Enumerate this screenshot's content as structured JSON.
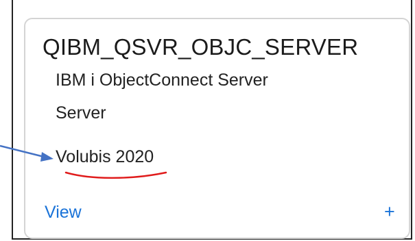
{
  "card": {
    "title": "QIBM_QSVR_OBJC_SERVER",
    "description": "IBM i ObjectConnect Server",
    "type": "Server",
    "vendor": "Volubis 2020",
    "view_label": "View",
    "expand_glyph": "+"
  },
  "annotations": {
    "arrow": {
      "icon": "arrow-right-icon",
      "color": "#4472c4"
    },
    "underline": {
      "icon": "red-underline-mark",
      "color": "#e01b1b"
    }
  },
  "colors": {
    "link": "#1a73d8",
    "text": "#222222",
    "card_border": "#d4d4d4"
  }
}
